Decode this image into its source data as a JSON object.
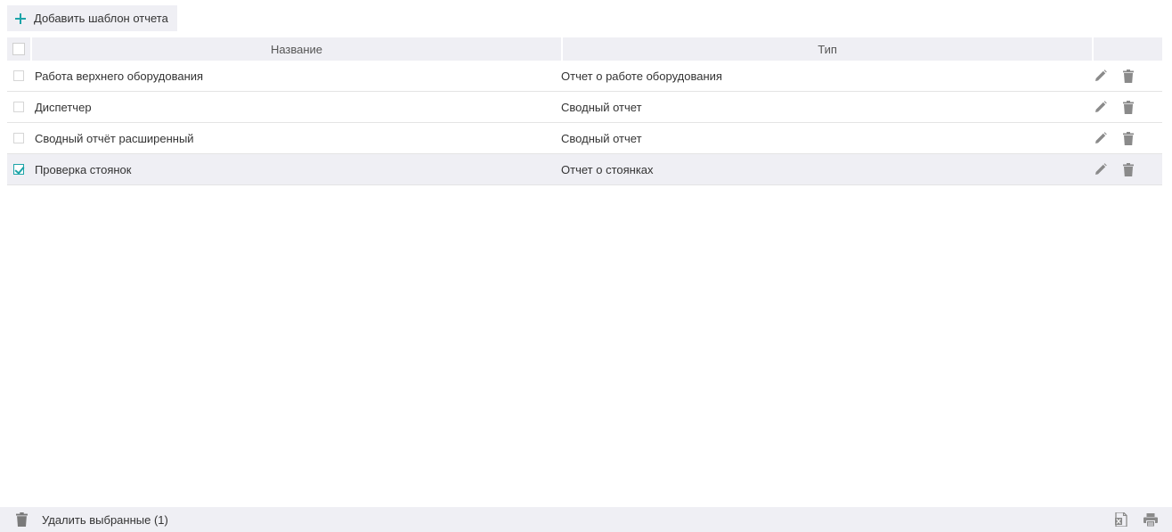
{
  "toolbar": {
    "add_label": "Добавить шаблон отчета",
    "add_icon": "plus-icon",
    "accent": "#1ca4a8"
  },
  "table": {
    "columns": [
      "Название",
      "Тип"
    ],
    "rows": [
      {
        "name": "Работа верхнего оборудования",
        "type": "Отчет о работе оборудования",
        "checked": false
      },
      {
        "name": "Диспетчер",
        "type": "Сводный отчет",
        "checked": false
      },
      {
        "name": "Сводный отчёт расширенный",
        "type": "Сводный отчет",
        "checked": false
      },
      {
        "name": "Проверка стоянок",
        "type": "Отчет о стоянках",
        "checked": true
      }
    ],
    "row_icons": [
      "pencil-icon",
      "trash-icon"
    ]
  },
  "footer": {
    "delete_selected_label": "Удалить выбранные (1)",
    "icons": [
      "trash-icon",
      "excel-export-icon",
      "print-icon"
    ]
  },
  "colors": {
    "header_bg": "#efeff4",
    "selected_bg": "#efeff4",
    "icon_gray": "#8a8a8a"
  }
}
